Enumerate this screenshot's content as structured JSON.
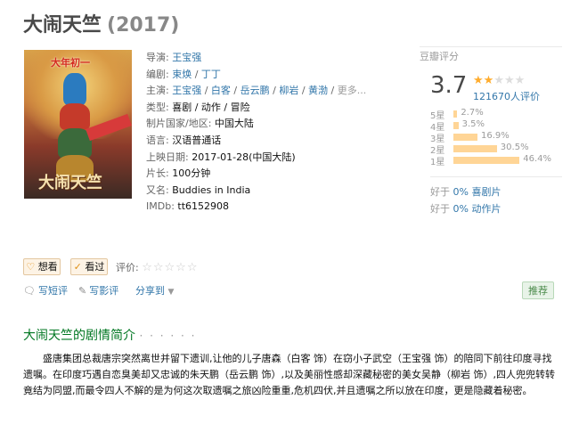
{
  "movie": {
    "title": "大闹天竺",
    "year": "(2017)"
  },
  "poster": {
    "tagline": "大年初一",
    "logo_text": "大闹天竺"
  },
  "info": {
    "director": {
      "label": "导演:",
      "names": [
        "王宝强"
      ]
    },
    "writer": {
      "label": "编剧:",
      "names": [
        "束焕",
        "丁丁"
      ]
    },
    "cast": {
      "label": "主演:",
      "names": [
        "王宝强",
        "白客",
        "岳云鹏",
        "柳岩",
        "黄渤"
      ],
      "more": "更多..."
    },
    "genre": {
      "label": "类型:",
      "value": "喜剧 / 动作 / 冒险"
    },
    "country": {
      "label": "制片国家/地区:",
      "value": "中国大陆"
    },
    "language": {
      "label": "语言:",
      "value": "汉语普通话"
    },
    "release": {
      "label": "上映日期:",
      "value": "2017-01-28(中国大陆)"
    },
    "runtime": {
      "label": "片长:",
      "value": "100分钟"
    },
    "aka": {
      "label": "又名:",
      "value": "Buddies in India"
    },
    "imdb": {
      "label": "IMDb:",
      "value": "tt6152908"
    }
  },
  "rating": {
    "header": "豆瓣评分",
    "score": "3.7",
    "stars_filled": 2,
    "votes": "121670人评价",
    "distribution": [
      {
        "label": "5星",
        "pct": "2.7%",
        "value": 2.7
      },
      {
        "label": "4星",
        "pct": "3.5%",
        "value": 3.5
      },
      {
        "label": "3星",
        "pct": "16.9%",
        "value": 16.9
      },
      {
        "label": "2星",
        "pct": "30.5%",
        "value": 30.5
      },
      {
        "label": "1星",
        "pct": "46.4%",
        "value": 46.4
      }
    ],
    "compare": [
      {
        "prefix": "好于",
        "link": "0% 喜剧片"
      },
      {
        "prefix": "好于",
        "link": "0% 动作片"
      }
    ],
    "star_color": "#ffac2d",
    "bar_color": "#ffd596"
  },
  "actions": {
    "want": "想看",
    "seen": "看过",
    "rate_label": "评价:",
    "rate_stars": "☆☆☆☆☆"
  },
  "links": {
    "short_review": "写短评",
    "review": "写影评",
    "share": "分享到",
    "recommend": "推荐"
  },
  "summary": {
    "title": "大闹天竺的剧情简介",
    "dots": "· · · · · ·",
    "text": "盛唐集团总裁唐宗突然离世并留下遗训,让他的儿子唐森（白客 饰）在窃小子武空（王宝强 饰）的陪同下前往印度寻找遗嘱。在印度巧遇自恋臭美却又忠诚的朱天鹏（岳云鹏 饰）,以及美丽性感却深藏秘密的美女吴静（柳岩 饰）,四人兜兜转转竟结为同盟,而最令四人不解的是为何这次取遗嘱之旅凶险重重,危机四伏,并且遗嘱之所以放在印度，更是隐藏着秘密。"
  }
}
